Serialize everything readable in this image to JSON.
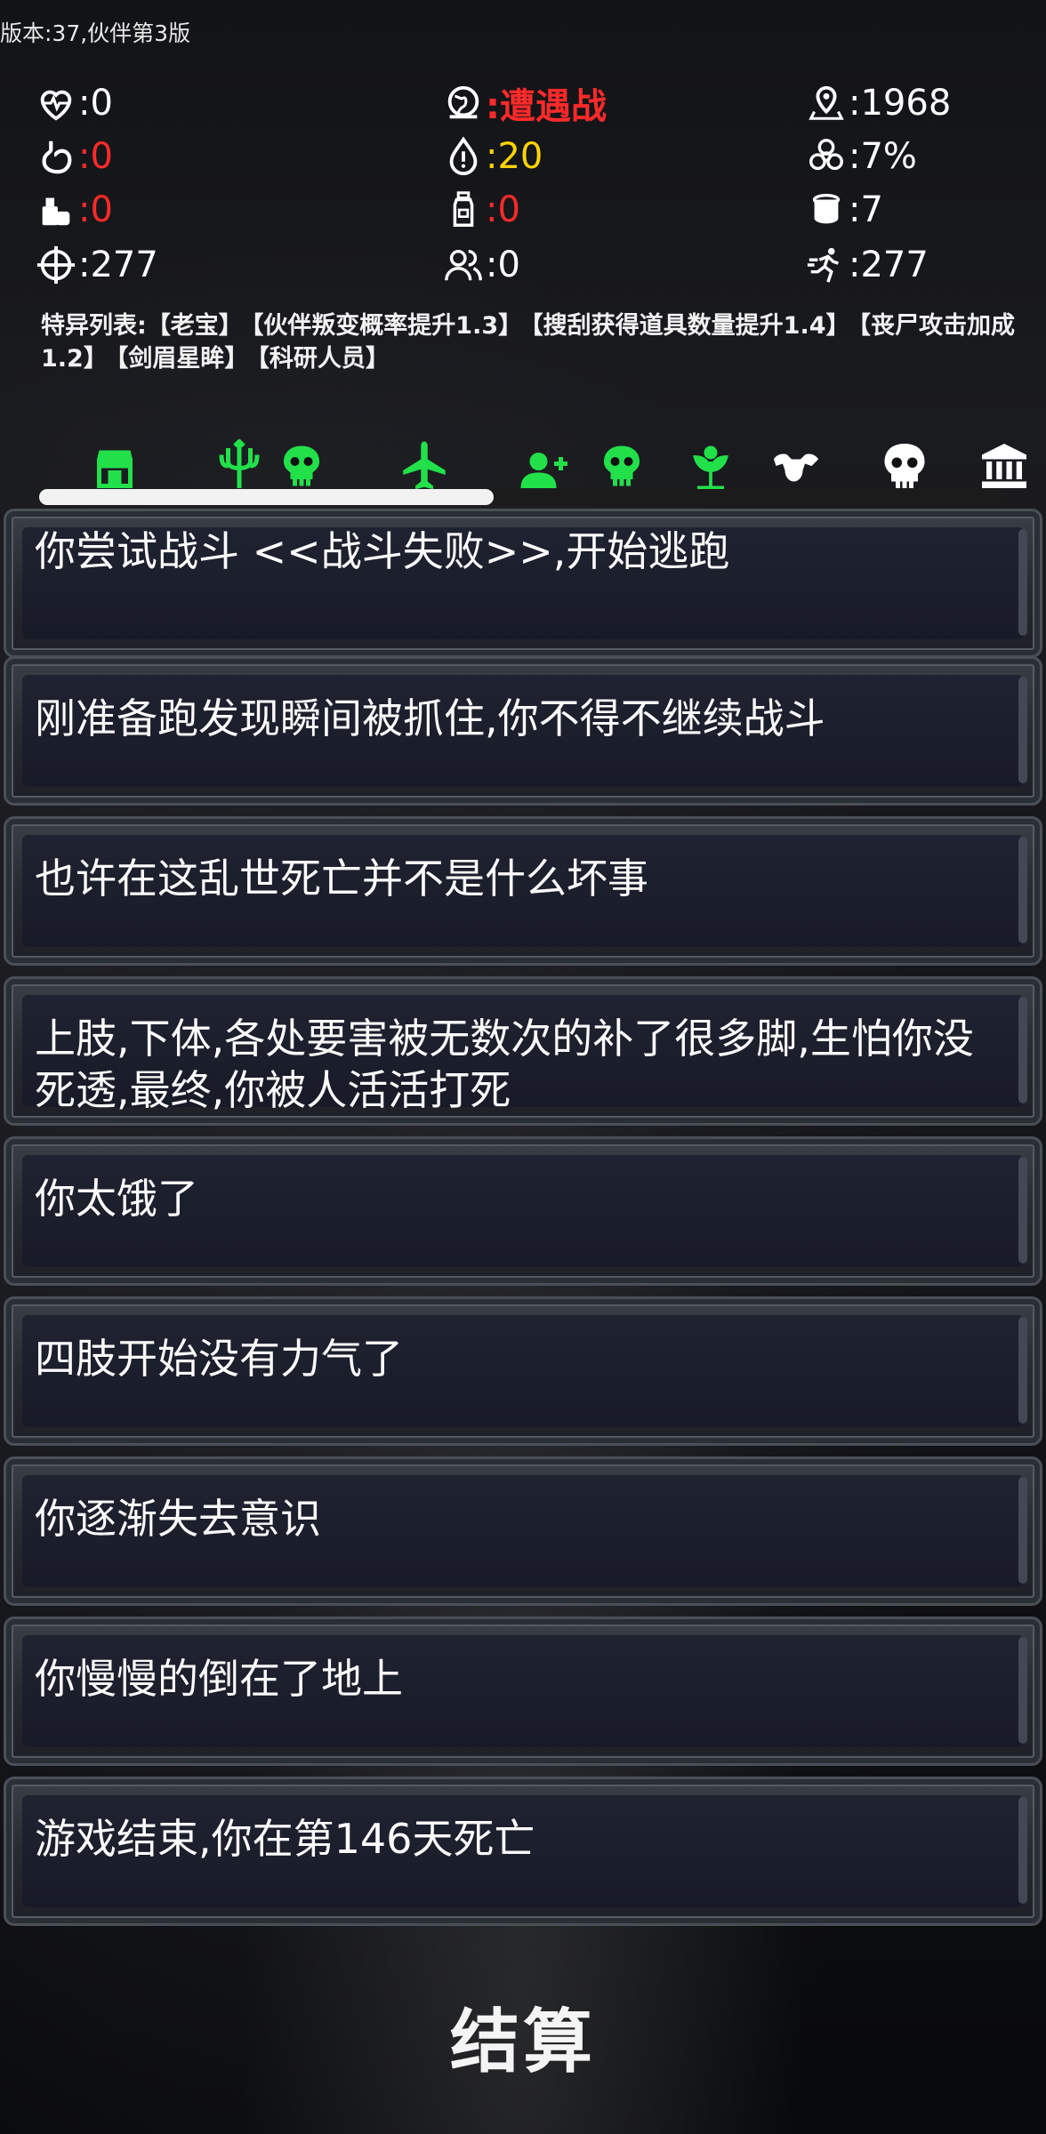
{
  "version": "版本:37,伙伴第3版",
  "stats": {
    "health": ":0",
    "event": ":遭遇战",
    "location": ":1968",
    "hunger": ":0",
    "water": ":20",
    "infection": ":7%",
    "food": ":0",
    "medicine": ":0",
    "ammo": ":7",
    "attack": ":277",
    "companions": ":0",
    "speed": ":277"
  },
  "traits": {
    "prefix": "特异列表:",
    "items": [
      "【老宝】",
      "【伙伴叛变概率提升1.3】",
      "【搜刮获得道具数量提升1.4】",
      "【丧尸攻击加成1.2】",
      "【剑眉星眸】",
      "【科研人员】"
    ]
  },
  "progress": {
    "fill": 0.47
  },
  "colors": {
    "red": "#ff2a2a",
    "yellow": "#ffd400",
    "green": "#22e04a",
    "white": "#f0f0f0"
  },
  "timeline_icons": [
    "shop-icon",
    "trident-icon",
    "skull-icon",
    "airplane-icon",
    "add-user-icon",
    "skull-icon",
    "plant-icon",
    "muscle-icon",
    "skull-icon",
    "bank-icon"
  ],
  "events": [
    "你尝试战斗 <<战斗失败>>,开始逃跑",
    "刚准备跑发现瞬间被抓住,你不得不继续战斗",
    "也许在这乱世死亡并不是什么坏事",
    "上肢,下体,各处要害被无数次的补了很多脚,生怕你没死透,最终,你被人活活打死",
    "你太饿了",
    "四肢开始没有力气了",
    "你逐渐失去意识",
    "你慢慢的倒在了地上",
    "游戏结束,你在第146天死亡"
  ],
  "settle_label": "结算"
}
